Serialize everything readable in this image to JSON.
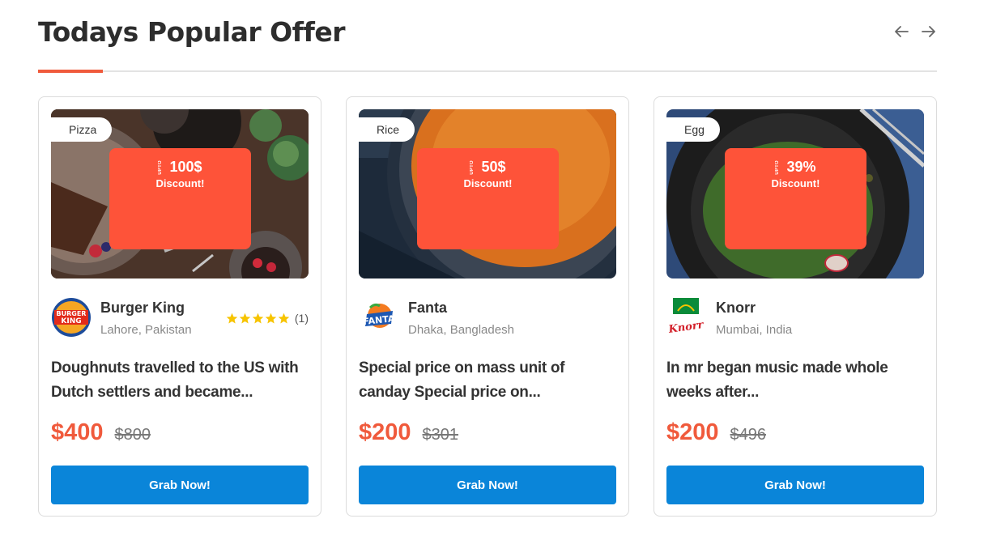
{
  "section": {
    "title": "Todays Popular Offer",
    "prev_icon": "arrow-left-icon",
    "next_icon": "arrow-right-icon"
  },
  "colors": {
    "accent": "#f05a3c",
    "discount_bg": "#fe5339",
    "button_bg": "#0a85d9",
    "star": "#f7c400"
  },
  "cards": [
    {
      "category": "Pizza",
      "discount_upto": "UPTO",
      "discount_value": "100$",
      "discount_label": "Discount!",
      "brand_name": "Burger King",
      "brand_location": "Lahore, Pakistan",
      "rating_stars": 5,
      "rating_count": "(1)",
      "description": "Doughnuts travelled to the US with Dutch settlers and became...",
      "price_new": "$400",
      "price_old": "$800",
      "button_label": "Grab Now!"
    },
    {
      "category": "Rice",
      "discount_upto": "UPTO",
      "discount_value": "50$",
      "discount_label": "Discount!",
      "brand_name": "Fanta",
      "brand_location": "Dhaka, Bangladesh",
      "description": "Special price on mass unit of canday Special price on...",
      "price_new": "$200",
      "price_old": "$301",
      "button_label": "Grab Now!"
    },
    {
      "category": "Egg",
      "discount_upto": "UPTO",
      "discount_value": "39%",
      "discount_label": "Discount!",
      "brand_name": "Knorr",
      "brand_location": "Mumbai, India",
      "description": "In mr began music made whole weeks after...",
      "price_new": "$200",
      "price_old": "$496",
      "button_label": "Grab Now!"
    }
  ]
}
